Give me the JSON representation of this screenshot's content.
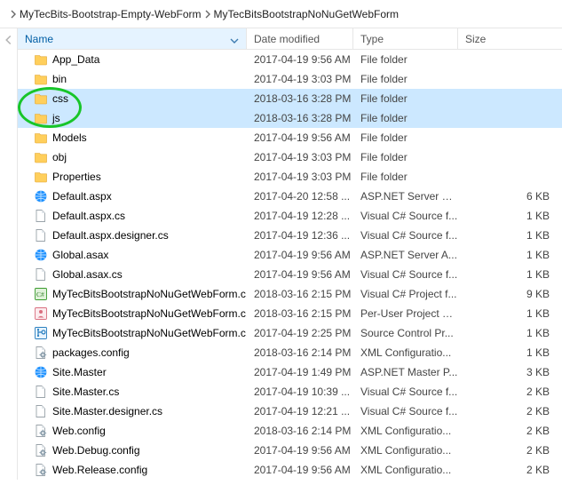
{
  "breadcrumb": {
    "items": [
      "MyTecBits-Bootstrap-Empty-WebForm",
      "MyTecBitsBootstrapNoNuGetWebForm"
    ]
  },
  "columns": {
    "name": "Name",
    "date": "Date modified",
    "type": "Type",
    "size": "Size"
  },
  "files": [
    {
      "icon": "folder",
      "name": "App_Data",
      "date": "2017-04-19 9:56 AM",
      "type": "File folder",
      "size": "",
      "selected": false
    },
    {
      "icon": "folder",
      "name": "bin",
      "date": "2017-04-19 3:03 PM",
      "type": "File folder",
      "size": "",
      "selected": false
    },
    {
      "icon": "folder",
      "name": "css",
      "date": "2018-03-16 3:28 PM",
      "type": "File folder",
      "size": "",
      "selected": true
    },
    {
      "icon": "folder",
      "name": "js",
      "date": "2018-03-16 3:28 PM",
      "type": "File folder",
      "size": "",
      "selected": true
    },
    {
      "icon": "folder",
      "name": "Models",
      "date": "2017-04-19 9:56 AM",
      "type": "File folder",
      "size": "",
      "selected": false
    },
    {
      "icon": "folder",
      "name": "obj",
      "date": "2017-04-19 3:03 PM",
      "type": "File folder",
      "size": "",
      "selected": false
    },
    {
      "icon": "folder",
      "name": "Properties",
      "date": "2017-04-19 3:03 PM",
      "type": "File folder",
      "size": "",
      "selected": false
    },
    {
      "icon": "aspx",
      "name": "Default.aspx",
      "date": "2017-04-20 12:58 ...",
      "type": "ASP.NET Server Pa...",
      "size": "6 KB",
      "selected": false
    },
    {
      "icon": "file",
      "name": "Default.aspx.cs",
      "date": "2017-04-19 12:28 ...",
      "type": "Visual C# Source f...",
      "size": "1 KB",
      "selected": false
    },
    {
      "icon": "file",
      "name": "Default.aspx.designer.cs",
      "date": "2017-04-19 12:36 ...",
      "type": "Visual C# Source f...",
      "size": "1 KB",
      "selected": false
    },
    {
      "icon": "aspx",
      "name": "Global.asax",
      "date": "2017-04-19 9:56 AM",
      "type": "ASP.NET Server A...",
      "size": "1 KB",
      "selected": false
    },
    {
      "icon": "file",
      "name": "Global.asax.cs",
      "date": "2017-04-19 9:56 AM",
      "type": "Visual C# Source f...",
      "size": "1 KB",
      "selected": false
    },
    {
      "icon": "csproj",
      "name": "MyTecBitsBootstrapNoNuGetWebForm.c...",
      "date": "2018-03-16 2:15 PM",
      "type": "Visual C# Project f...",
      "size": "9 KB",
      "selected": false
    },
    {
      "icon": "user",
      "name": "MyTecBitsBootstrapNoNuGetWebForm.c...",
      "date": "2018-03-16 2:15 PM",
      "type": "Per-User Project O...",
      "size": "1 KB",
      "selected": false
    },
    {
      "icon": "vspscc",
      "name": "MyTecBitsBootstrapNoNuGetWebForm.c...",
      "date": "2017-04-19 2:25 PM",
      "type": "Source Control Pr...",
      "size": "1 KB",
      "selected": false
    },
    {
      "icon": "config",
      "name": "packages.config",
      "date": "2018-03-16 2:14 PM",
      "type": "XML Configuratio...",
      "size": "1 KB",
      "selected": false
    },
    {
      "icon": "aspx",
      "name": "Site.Master",
      "date": "2017-04-19 1:49 PM",
      "type": "ASP.NET Master P...",
      "size": "3 KB",
      "selected": false
    },
    {
      "icon": "file",
      "name": "Site.Master.cs",
      "date": "2017-04-19 10:39 ...",
      "type": "Visual C# Source f...",
      "size": "2 KB",
      "selected": false
    },
    {
      "icon": "file",
      "name": "Site.Master.designer.cs",
      "date": "2017-04-19 12:21 ...",
      "type": "Visual C# Source f...",
      "size": "2 KB",
      "selected": false
    },
    {
      "icon": "config",
      "name": "Web.config",
      "date": "2018-03-16 2:14 PM",
      "type": "XML Configuratio...",
      "size": "2 KB",
      "selected": false
    },
    {
      "icon": "config",
      "name": "Web.Debug.config",
      "date": "2017-04-19 9:56 AM",
      "type": "XML Configuratio...",
      "size": "2 KB",
      "selected": false
    },
    {
      "icon": "config",
      "name": "Web.Release.config",
      "date": "2017-04-19 9:56 AM",
      "type": "XML Configuratio...",
      "size": "2 KB",
      "selected": false
    }
  ]
}
